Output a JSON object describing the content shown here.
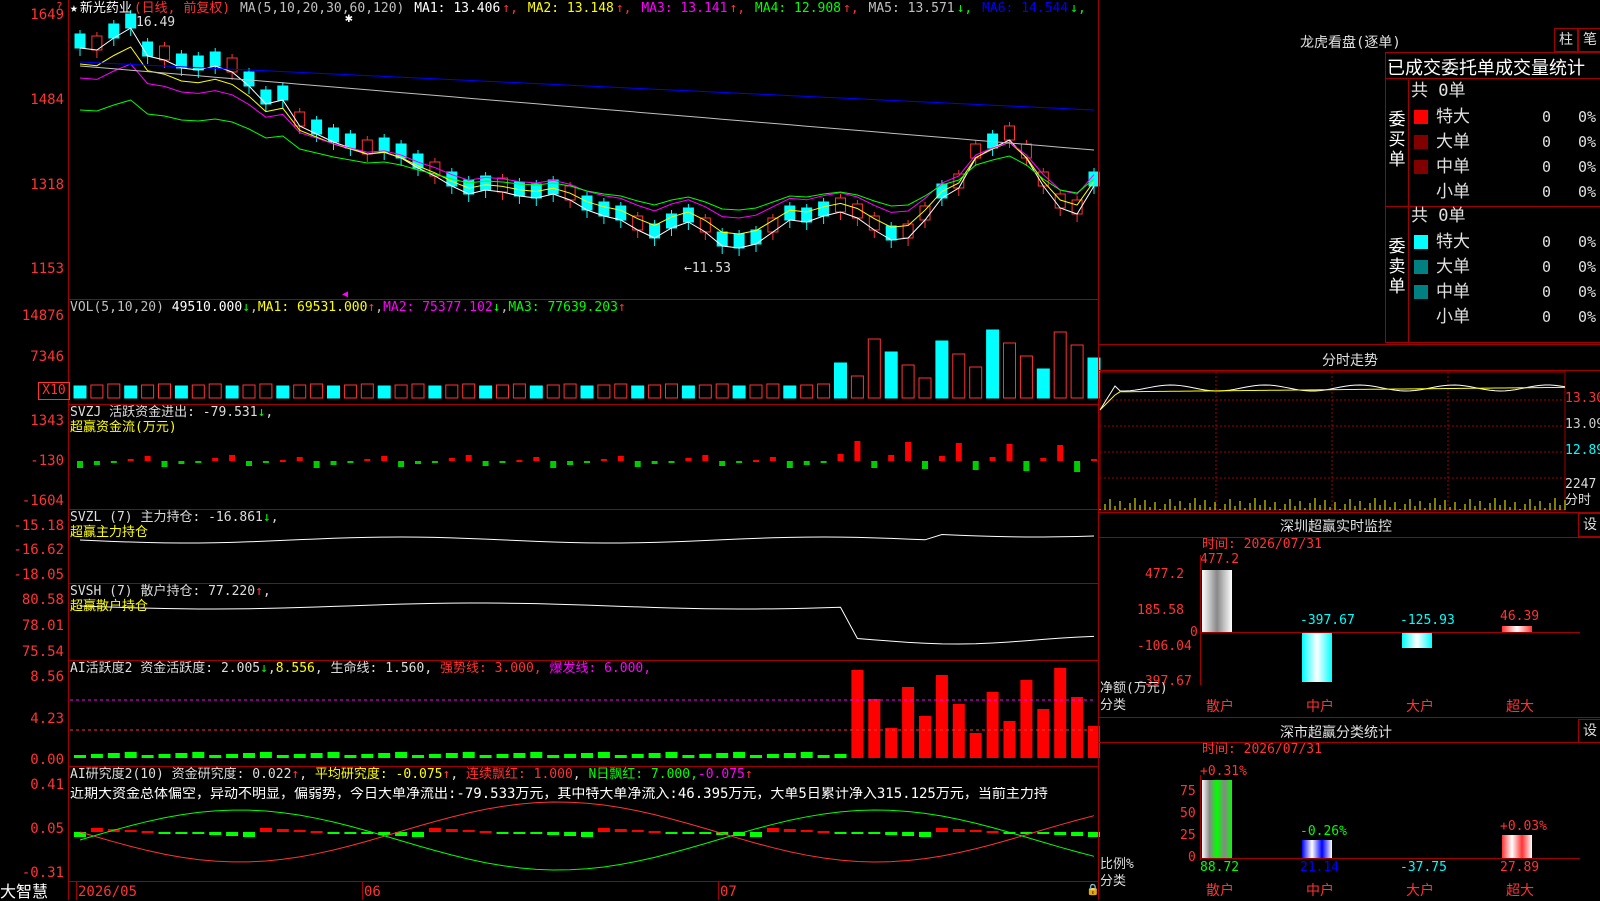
{
  "stock": {
    "name": "新光药业",
    "mode": "(日线, 前复权)"
  },
  "ma": {
    "label": "MA(5,10,20,30,60,120)",
    "items": [
      {
        "t": "MA1: 13.406",
        "a": "↑",
        "c": "#ffffff"
      },
      {
        "t": "MA2: 13.148",
        "a": "↑",
        "c": "#ffff00"
      },
      {
        "t": "MA3: 13.141",
        "a": "↑",
        "c": "#ff00ff"
      },
      {
        "t": "MA4: 12.908",
        "a": "↑",
        "c": "#00ff00"
      },
      {
        "t": "MA5: 13.571",
        "a": "↓",
        "c": "#c0c0c0"
      },
      {
        "t": "MA6: 14.544",
        "a": "↓",
        "c": "#0000ff"
      }
    ]
  },
  "price_axis": {
    "top": "1649",
    "l1": "1484",
    "l2": "1318",
    "l3": "1153"
  },
  "price_marks": {
    "high": "16.49",
    "low": "←11.53"
  },
  "vol": {
    "label": "VOL(5,10,20)",
    "v": "49510.000",
    "ma1": "MA1: 69531.000",
    "ma2": "MA2: 75377.102",
    "ma3": "MA3: 77639.203",
    "y1": "14876",
    "y2": "7346",
    "unit": "X10"
  },
  "svzj": {
    "label": "SVZJ  活跃资金进出: -79.531",
    "sub": "超赢资金流(万元)",
    "y1": "1343",
    "y2": "-130",
    "y3": "-1604"
  },
  "svzl": {
    "label": "SVZL (7) 主力持仓: -16.861",
    "sub": "超赢主力持仓",
    "y1": "-15.18",
    "y2": "-16.62",
    "y3": "-18.05"
  },
  "svsh": {
    "label": "SVSH (7) 散户持仓: 77.220",
    "sub": "超赢散户持仓",
    "y1": "80.58",
    "y2": "78.01",
    "y3": "75.54"
  },
  "aihy": {
    "label": "AI活跃度2 资金活跃度: 2.005",
    "v2": "8.556",
    "life": "生命线: 1.560,",
    "strong": "强势线: 3.000,",
    "burst": "爆发线: 6.000,",
    "y1": "8.56",
    "y2": "4.23",
    "y3": "0.00"
  },
  "aiyj": {
    "label": "AI研究度2(10) 资金研究度: 0.022",
    "avg": "平均研究度: -0.075",
    "lx": "连续飘红: 1.000",
    "nr": "N日飘红: 7.000,",
    "last": "-0.075",
    "text": "近期大资金总体偏空，异动不明显，偏弱势，今日大单净流出:-79.533万元，其中特大单净流入:46.395万元，大单5日累计净入315.125万元，当前主力持",
    "y1": "0.41",
    "y2": "0.05",
    "y3": "-0.31"
  },
  "dates": {
    "d1": "2026/05",
    "d2": "06",
    "d3": "07"
  },
  "brand": "大智慧",
  "longhu": {
    "title": "龙虎看盘(逐单)",
    "btn1": "柱",
    "btn2": "笔",
    "tabs": "已成交委托单成交量统计",
    "buy": {
      "side": "委买单",
      "count": "共 0单",
      "rows": [
        {
          "n": "特大",
          "v": "0",
          "p": "0%"
        },
        {
          "n": "大单",
          "v": "0",
          "p": "0%"
        },
        {
          "n": "中单",
          "v": "0",
          "p": "0%"
        },
        {
          "n": "小单",
          "v": "0",
          "p": "0%"
        }
      ]
    },
    "sell": {
      "side": "委卖单",
      "count": "共 0单",
      "rows": [
        {
          "n": "特大",
          "v": "0",
          "p": "0%"
        },
        {
          "n": "大单",
          "v": "0",
          "p": "0%"
        },
        {
          "n": "中单",
          "v": "0",
          "p": "0%"
        },
        {
          "n": "小单",
          "v": "0",
          "p": "0%"
        }
      ]
    }
  },
  "fenshi": {
    "title": "分时走势",
    "y1": "13.30",
    "y2": "13.09",
    "y3": "12.89",
    "vol": "2247",
    "unit": "分时"
  },
  "monitor": {
    "title": "深圳超赢实时监控",
    "btn": "设",
    "time": "时间: 2026/07/31",
    "y1": "477.2",
    "y2": "185.58",
    "y3": "0",
    "y4": "-106.04",
    "y5": "-397.67",
    "unit": "净额(万元)",
    "cat": "分类",
    "bars": [
      {
        "cat": "散户",
        "label": "477.2"
      },
      {
        "cat": "中户",
        "label": "-397.67"
      },
      {
        "cat": "大户",
        "label": "-125.93"
      },
      {
        "cat": "超大",
        "label": "46.39"
      }
    ]
  },
  "classify": {
    "title": "深市超赢分类统计",
    "btn": "设",
    "time": "时间: 2026/07/31",
    "y1": "75",
    "y2": "50",
    "y3": "25",
    "y4": "0",
    "unit": "比例%",
    "cat": "分类",
    "bars": [
      {
        "cat": "散户",
        "top": "+0.31%",
        "bottom": "88.72"
      },
      {
        "cat": "中户",
        "top": "-0.26%",
        "bottom": "21.14"
      },
      {
        "cat": "大户",
        "top": "",
        "bottom": "-37.75"
      },
      {
        "cat": "超大",
        "top": "+0.03%",
        "bottom": "27.89"
      }
    ]
  }
}
